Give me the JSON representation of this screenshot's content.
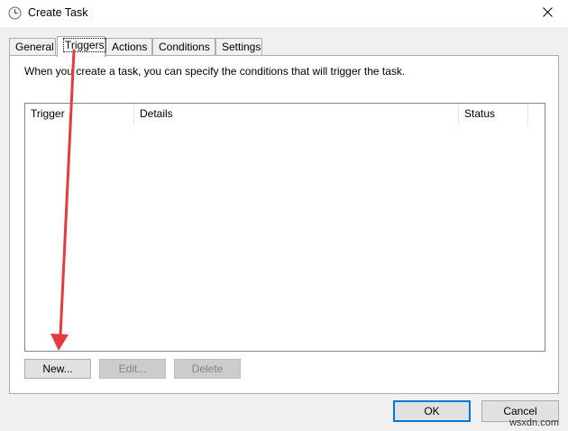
{
  "window": {
    "title": "Create Task",
    "icon": "clock-icon",
    "close_glyph": "✕"
  },
  "tabs": [
    {
      "label": "General"
    },
    {
      "label": "Triggers",
      "active": true
    },
    {
      "label": "Actions"
    },
    {
      "label": "Conditions"
    },
    {
      "label": "Settings"
    }
  ],
  "triggers": {
    "description": "When you create a task, you can specify the conditions that will trigger the task.",
    "columns": [
      "Trigger",
      "Details",
      "Status"
    ],
    "rows": [],
    "buttons": {
      "new": "New...",
      "edit": "Edit...",
      "delete": "Delete"
    }
  },
  "footer": {
    "ok": "OK",
    "cancel": "Cancel"
  },
  "watermark": "wsxdn.com",
  "colors": {
    "annotation_arrow": "#e8393c",
    "focus_border": "#0078d7"
  }
}
